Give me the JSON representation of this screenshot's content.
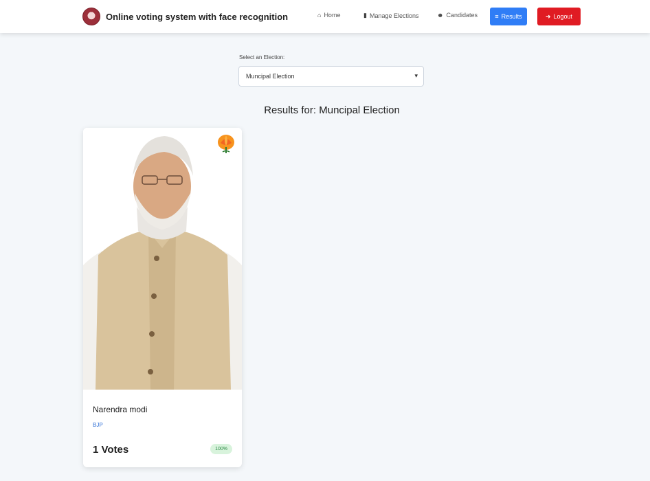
{
  "navbar": {
    "brand_text": "Online voting system with face recognition",
    "links": [
      {
        "label": "Home",
        "icon": "home-icon"
      },
      {
        "label": "Manage Elections",
        "icon": "briefcase-icon"
      },
      {
        "label": "Candidates",
        "icon": "users-icon"
      }
    ],
    "results_label": "Results",
    "logout_label": "Logout"
  },
  "election_select": {
    "label": "Select an Election:",
    "selected": "Muncipal Election"
  },
  "results": {
    "title": "Results for: Muncipal Election"
  },
  "candidates": [
    {
      "name": "Narendra modi",
      "party": "BJP",
      "votes_text": "1 Votes",
      "percent_text": "100%"
    }
  ],
  "colors": {
    "primary": "#2f7df6",
    "danger": "#e01b23",
    "background": "#f4f7fa",
    "badge_bg": "#d8f3dc",
    "badge_text": "#2d8a46"
  }
}
